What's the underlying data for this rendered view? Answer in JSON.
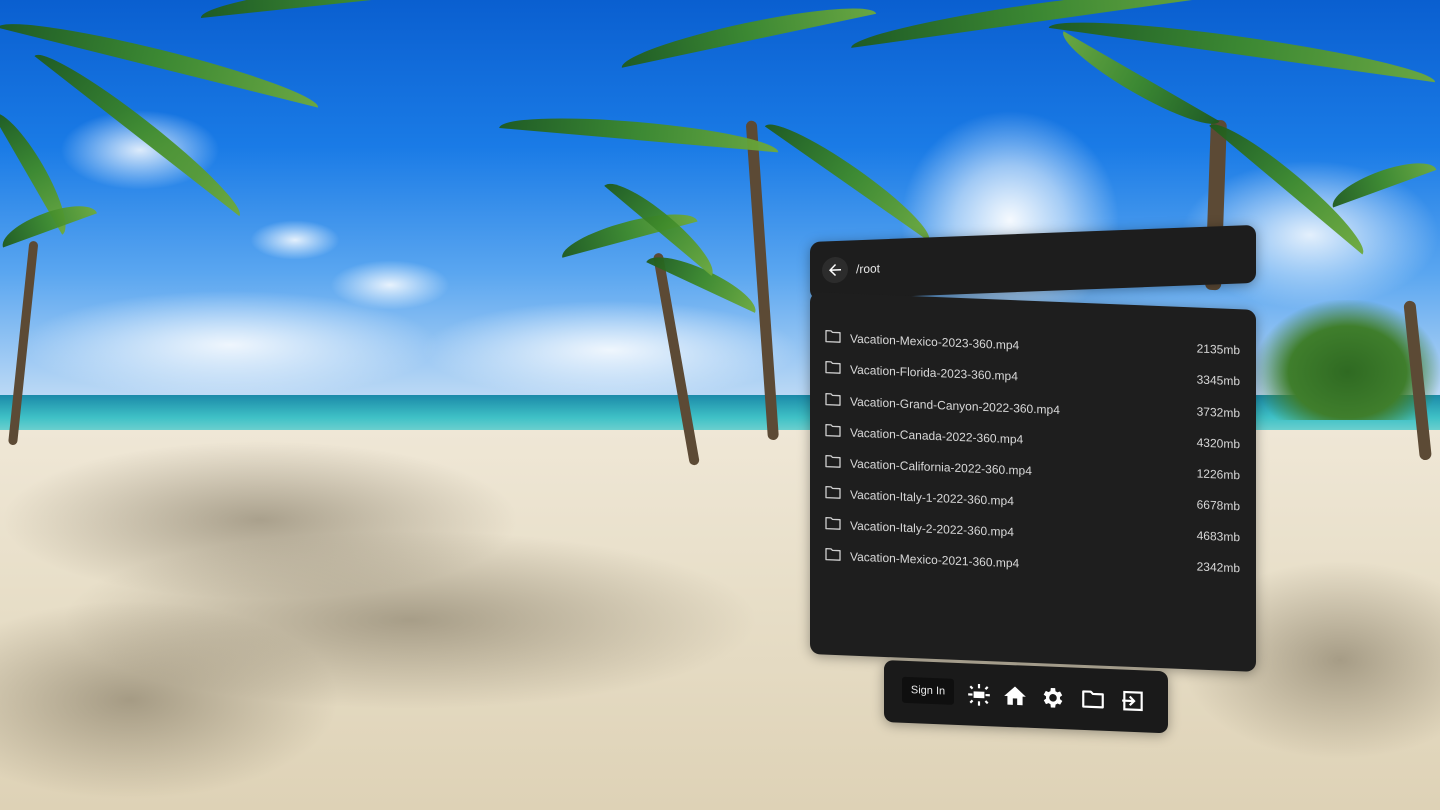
{
  "path_bar": {
    "back_icon": "arrow-left-icon",
    "current_path": "/root"
  },
  "files": [
    {
      "name": "Vacation-Mexico-2023-360.mp4",
      "size": "2135mb",
      "icon": "folder-icon"
    },
    {
      "name": "Vacation-Florida-2023-360.mp4",
      "size": "3345mb",
      "icon": "folder-icon"
    },
    {
      "name": "Vacation-Grand-Canyon-2022-360.mp4",
      "size": "3732mb",
      "icon": "folder-icon"
    },
    {
      "name": "Vacation-Canada-2022-360.mp4",
      "size": "4320mb",
      "icon": "folder-icon"
    },
    {
      "name": "Vacation-California-2022-360.mp4",
      "size": "1226mb",
      "icon": "folder-icon"
    },
    {
      "name": "Vacation-Italy-1-2022-360.mp4",
      "size": "6678mb",
      "icon": "folder-icon"
    },
    {
      "name": "Vacation-Italy-2-2022-360.mp4",
      "size": "4683mb",
      "icon": "folder-icon"
    },
    {
      "name": "Vacation-Mexico-2021-360.mp4",
      "size": "2342mb",
      "icon": "folder-icon"
    }
  ],
  "toolbar": {
    "sign_in_label": "Sign In",
    "icons": [
      "brightness-icon",
      "home-icon",
      "gear-icon",
      "folder-icon",
      "exit-icon"
    ]
  },
  "colors": {
    "panel_bg": "#1e1e1e",
    "text": "#d8d8d8",
    "icon": "#ffffff"
  }
}
